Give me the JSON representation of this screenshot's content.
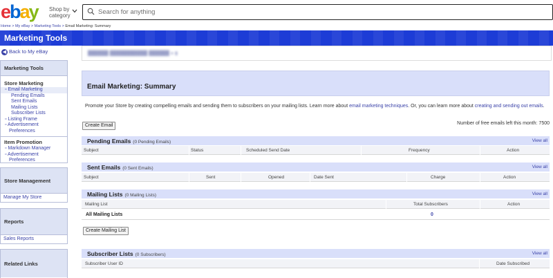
{
  "header": {
    "logo": {
      "e": "e",
      "b": "b",
      "a": "a",
      "y": "y"
    },
    "shop_by_line1": "Shop by",
    "shop_by_line2": "category",
    "search_placeholder": "Search for anything"
  },
  "breadcrumb": {
    "items": [
      "Home",
      "My eBay",
      "Marketing Tools"
    ],
    "current": "Email Marketing: Summary",
    "separator": " > "
  },
  "band": {
    "title": "Marketing Tools"
  },
  "sidebar": {
    "back_label": "Back to My eBay",
    "marketing_tools": {
      "title": "Marketing Tools",
      "store_marketing": "Store Marketing",
      "email_marketing": "Email Marketing",
      "email_sub": [
        "Pending Emails",
        "Sent Emails",
        "Mailing Lists",
        "Subscriber Lists"
      ],
      "listing_frame": "Listing Frame",
      "advertisement_1": "Advertisement",
      "preferences_1": "Preferences",
      "item_promotion": "Item Promotion",
      "markdown_manager": "Markdown Manager",
      "advertisement_2": "Advertisement",
      "preferences_2": "Preferences"
    },
    "store_management": {
      "title": "Store Management",
      "link": "Manage My Store"
    },
    "reports": {
      "title": "Reports",
      "link": "Sales Reports"
    },
    "related_links": {
      "title": "Related Links"
    }
  },
  "main": {
    "page_title": "Email Marketing: Summary",
    "description_before": "Promote your Store by creating compelling emails and sending them to subscribers on your mailing lists. Learn more about ",
    "link_techniques": "email marketing techniques",
    "description_middle": ". Or, you can learn more about ",
    "link_creating": "creating and sending out emails",
    "description_after": ".",
    "create_email_label": "Create Email",
    "free_emails_text": "Number of free emails left this month:",
    "free_emails_count": "7500",
    "pending": {
      "title": "Pending Emails",
      "count": "(0 Pending Emails)",
      "view_all": "View all",
      "columns": [
        "Subject",
        "Status",
        "Scheduled Send Date",
        "Frequency",
        "Action"
      ]
    },
    "sent": {
      "title": "Sent Emails",
      "count": "(0 Sent Emails)",
      "view_all": "View all",
      "columns": [
        "Subject",
        "Sent",
        "Opened",
        "Date Sent",
        "Charge",
        "Action"
      ]
    },
    "mailing": {
      "title": "Mailing Lists",
      "count": "(0 Mailing Lists)",
      "view_all": "View all",
      "columns": [
        "Mailing List",
        "Total Subscribers",
        "Action"
      ],
      "row_name": "All Mailing Lists",
      "row_total": "0"
    },
    "create_mailing_label": "Create Mailing List",
    "subscriber": {
      "title": "Subscriber Lists",
      "count": "(0 Subscribers)",
      "view_all": "View all",
      "columns": [
        "Subscriber User ID",
        "Date Subscribed"
      ]
    }
  }
}
